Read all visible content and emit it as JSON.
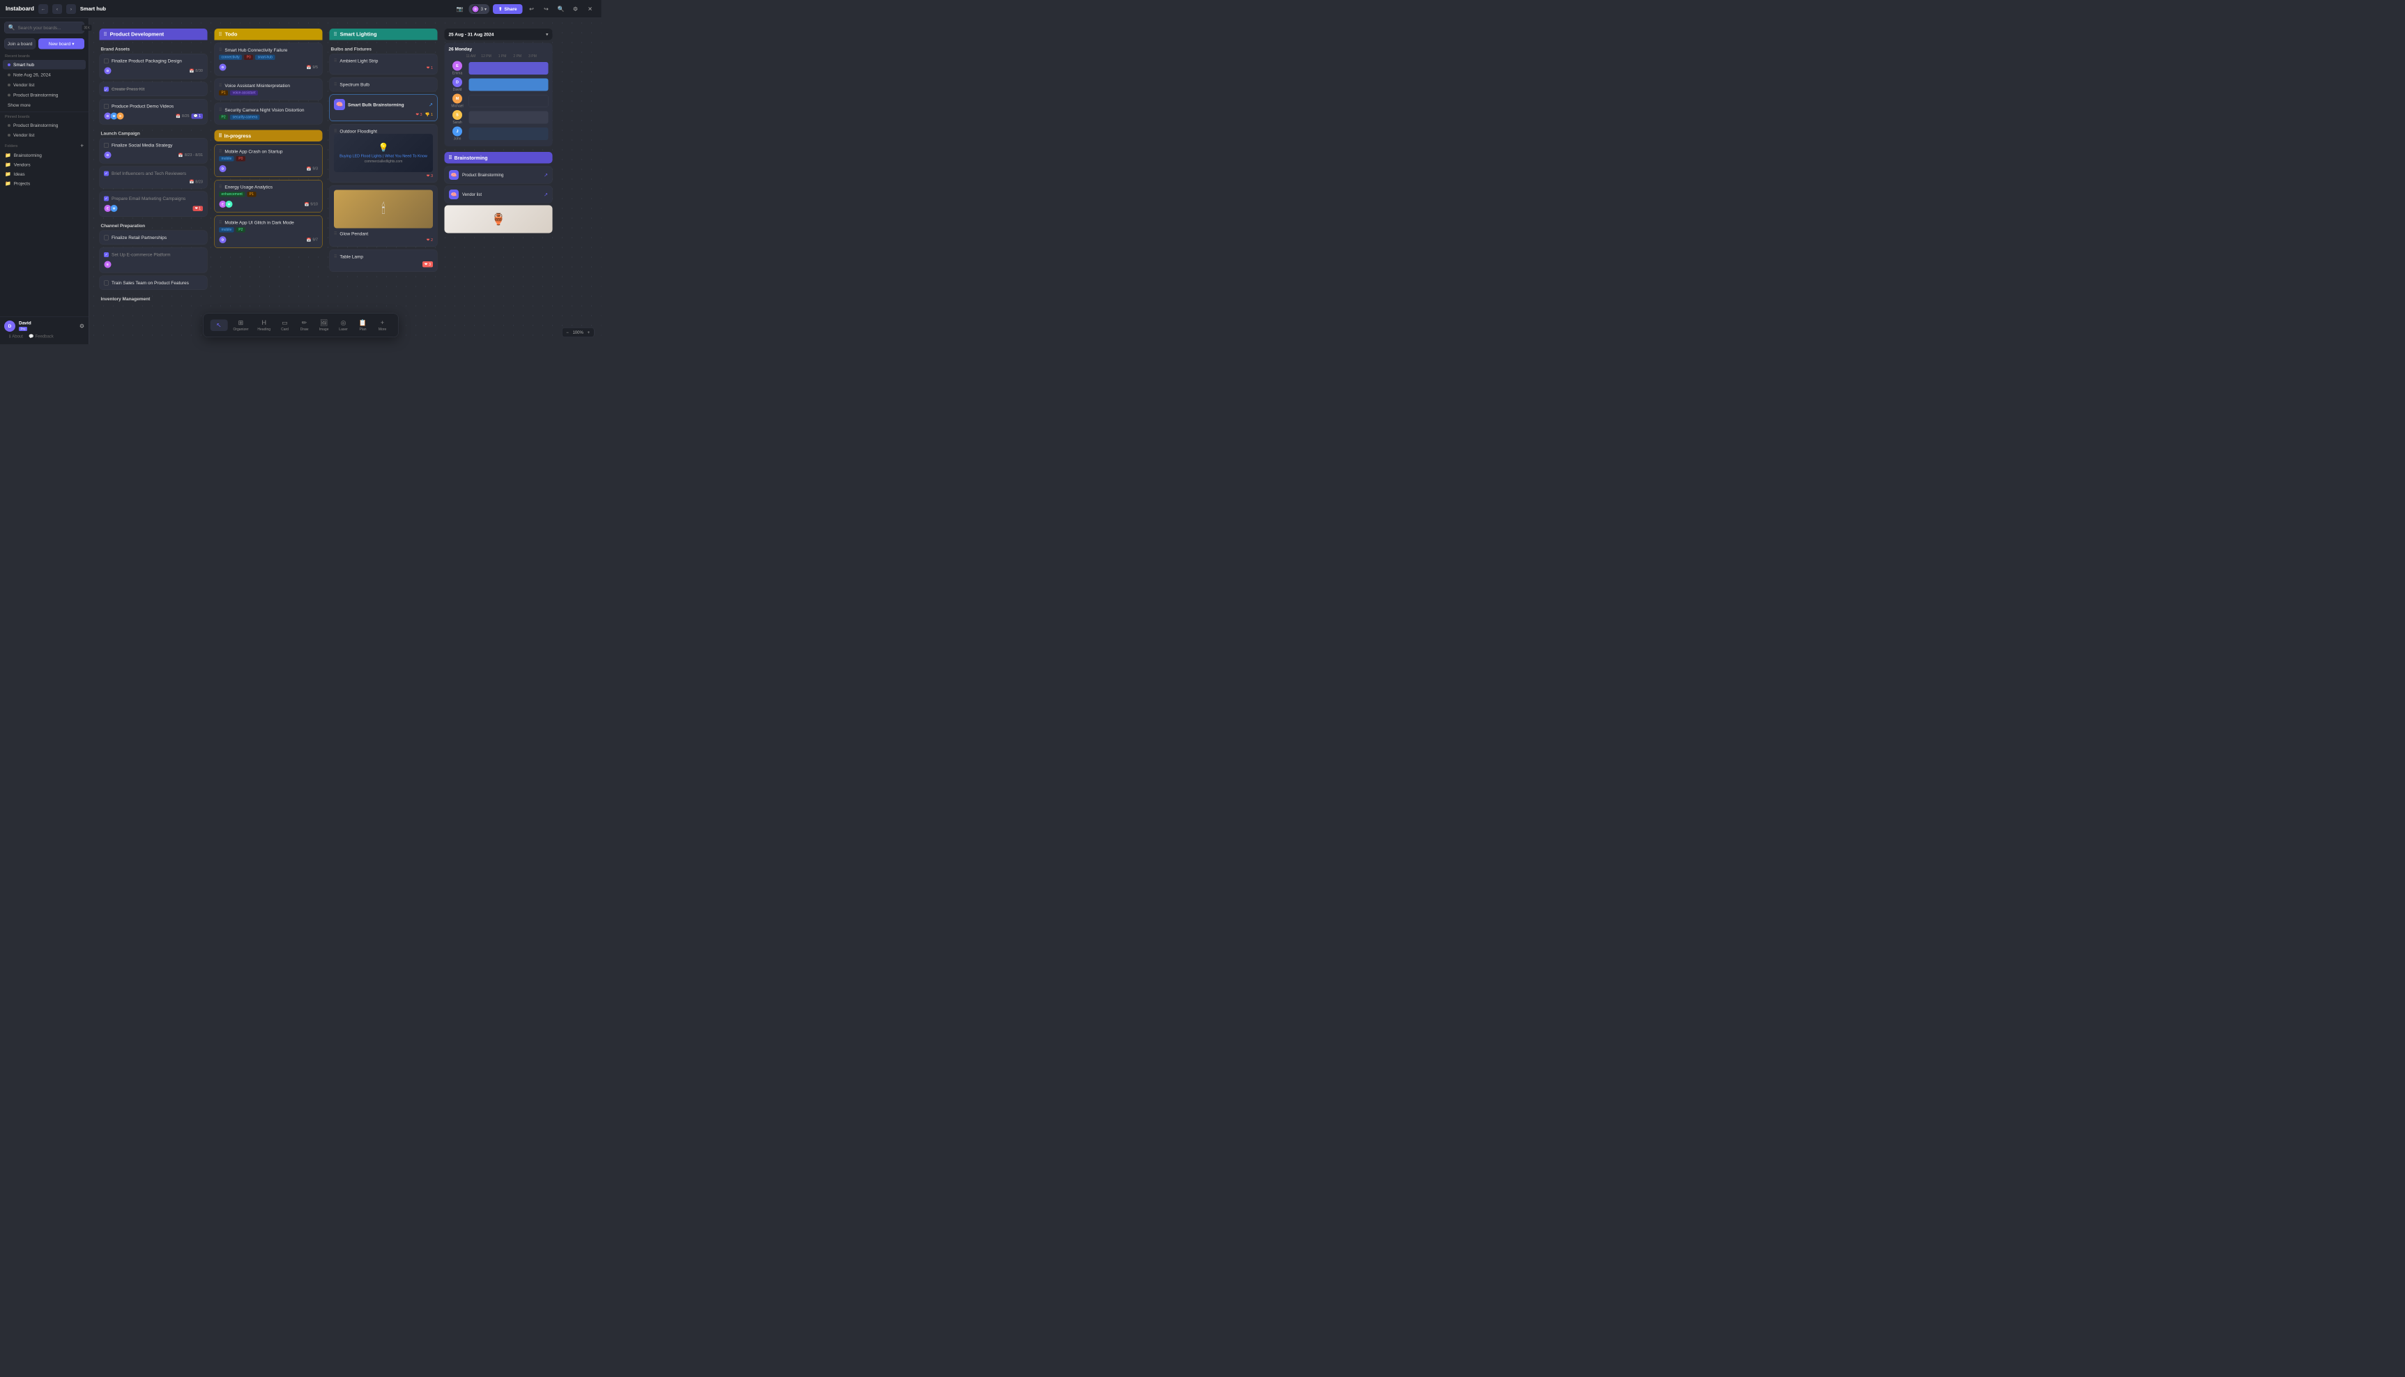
{
  "app": {
    "name": "Instaboard",
    "board_name": "Smart hub",
    "close_icon": "✕",
    "back_icon": "←",
    "forward_icon": "→",
    "undo_icon": "↩",
    "redo_icon": "↪"
  },
  "topbar": {
    "board_name": "Smart hub",
    "members_count": "3",
    "share_label": "Share",
    "share_icon": "⬆",
    "search_icon": "🔍",
    "settings_icon": "⚙",
    "close_icon": "✕",
    "undo_icon": "↩",
    "redo_icon": "↪",
    "camera_icon": "📷"
  },
  "sidebar": {
    "search_placeholder": "Search your boards...",
    "search_shortcut": "⌘K",
    "join_board_label": "Join a board",
    "new_board_label": "New board",
    "recent_label": "Recent boards",
    "recent_items": [
      {
        "label": "Smart hub",
        "active": true
      },
      {
        "label": "Note Aug 26, 2024"
      },
      {
        "label": "Vendor list"
      },
      {
        "label": "Product Brainstorming"
      }
    ],
    "show_more": "Show more",
    "pinned_label": "Pinned boards",
    "pinned_items": [
      {
        "label": "Product Brainstorming"
      },
      {
        "label": "Vendor list"
      }
    ],
    "folders_label": "Folders",
    "folders": [
      {
        "label": "Brainstorming"
      },
      {
        "label": "Vendors"
      },
      {
        "label": "Ideas"
      },
      {
        "label": "Projects"
      }
    ],
    "about_label": "About",
    "feedback_label": "Feedback",
    "user": {
      "name": "David",
      "badge": "Pro",
      "initial": "D"
    }
  },
  "columns": {
    "product_dev": {
      "title": "Product Development",
      "sections": {
        "brand_assets": {
          "label": "Brand Assets",
          "cards": [
            {
              "title": "Finalize Product Packaging Design",
              "checked": false,
              "date": "8/30",
              "avatar_colors": [
                "#7c6af7"
              ]
            },
            {
              "title": "Create Press Kit",
              "checked": true,
              "date": ""
            },
            {
              "title": "Produce Product Demo Videos",
              "checked": false,
              "date": "8/25",
              "has_badge": true,
              "badge_count": "1",
              "avatars": [
                "#7c6af7",
                "#4a9af7",
                "#f7a24a"
              ]
            }
          ]
        },
        "launch_campaign": {
          "label": "Launch Campaign",
          "cards": [
            {
              "title": "Finalize Social Media Strategy",
              "checked": false,
              "date": "8/23 - 8/31",
              "avatar_colors": [
                "#7c6af7"
              ]
            },
            {
              "title": "Brief Influencers and Tech Reviewers",
              "checked": true,
              "date": "8/23"
            },
            {
              "title": "Prepare Email Marketing Campaigns",
              "checked": true,
              "date": "",
              "heart": "1",
              "avatars": [
                "#c46af7",
                "#4a9af7"
              ]
            }
          ]
        },
        "channel_prep": {
          "label": "Channel Preparation",
          "cards": [
            {
              "title": "Finalize Retail Partnerships",
              "checked": false
            },
            {
              "title": "Set Up E-commerce Platform",
              "checked": true,
              "avatar_colors": [
                "#c46af7"
              ]
            },
            {
              "title": "Train Sales Team on Product Features",
              "checked": false
            }
          ]
        },
        "inventory": {
          "label": "Inventory Management"
        }
      }
    },
    "todo": {
      "title": "Todo",
      "cards": [
        {
          "title": "Smart Hub Connectivity Failure",
          "tags": [
            "connectivity",
            "P0",
            "snart-hub"
          ],
          "date": "9/5",
          "avatar_colors": [
            "#7c6af7"
          ]
        },
        {
          "title": "Voice Assistant Misinterpretation",
          "tags": [
            "P1",
            "voice-assistant"
          ],
          "avatar_colors": []
        },
        {
          "title": "Security Camera Night Vision Distortion",
          "tags": [
            "P2",
            "security-camera"
          ],
          "avatar_colors": []
        }
      ]
    },
    "smart_lighting": {
      "title": "Smart Lighting",
      "sections": {
        "bulbs_fixtures": {
          "label": "Bulbs and Fixtures",
          "cards": [
            {
              "title": "Ambient Light Strip",
              "heart": "1"
            },
            {
              "title": "Spectrum Bulb"
            },
            {
              "title": "Smart Bulk Brainstorming",
              "has_external": true,
              "hearts": "3",
              "thumbsdown": "1"
            },
            {
              "title": "Outdoor Floodlight",
              "has_image": true,
              "hearts": "3",
              "image_text": "Buying LED Flood Lights | What You Need To Know",
              "image_sub": "commercialledlights.com"
            },
            {
              "title": "Glow Pendant",
              "heart": "2"
            },
            {
              "title": "Table Lamp",
              "hearts": "3"
            }
          ]
        }
      }
    }
  },
  "inprogress": {
    "title": "In-progress",
    "cards": [
      {
        "title": "Mobile App Crash on Startup",
        "tags": [
          "mobile",
          "P0"
        ],
        "date": "9/3",
        "avatar_colors": [
          "#7c6af7"
        ]
      },
      {
        "title": "Energy Usage Analytics",
        "tags": [
          "enhancement",
          "P1"
        ],
        "date": "9/10",
        "avatars": [
          "#c46af7",
          "#4af7c4"
        ]
      },
      {
        "title": "Mobile App UI Glitch in Dark Mode",
        "tags": [
          "mobile",
          "P2"
        ],
        "date": "9/7",
        "avatar_colors": [
          "#7c6af7"
        ]
      }
    ]
  },
  "calendar": {
    "title": "25 Aug - 31 Aug 2024",
    "day": "26 Monday",
    "times": [
      "11 AM",
      "12 PM",
      "1 PM",
      "2 PM",
      "3 PM"
    ],
    "people": [
      {
        "name": "Emma",
        "initial": "E",
        "color": "#c46af7"
      },
      {
        "name": "David",
        "initial": "D",
        "color": "#7c6af7"
      },
      {
        "name": "Michael",
        "initial": "M",
        "color": "#f7a24a"
      },
      {
        "name": "Sarah",
        "initial": "S",
        "color": "#f7c24a"
      },
      {
        "name": "John",
        "initial": "J",
        "color": "#4a9af7"
      }
    ]
  },
  "brainstorm": {
    "title": "Brainstorming",
    "items": [
      {
        "name": "Product Brainstorming",
        "heart": "1"
      },
      {
        "name": "Vendor list",
        "heart": "1"
      }
    ]
  },
  "toolbar": {
    "items": [
      {
        "label": "Organizer",
        "icon": "⊞",
        "active": false
      },
      {
        "label": "Heading",
        "icon": "H",
        "active": false
      },
      {
        "label": "Card",
        "icon": "▭",
        "active": false
      },
      {
        "label": "Draw",
        "icon": "✏",
        "active": false
      },
      {
        "label": "Image",
        "icon": "🖼",
        "active": false
      },
      {
        "label": "Laser",
        "icon": "◎",
        "active": false
      },
      {
        "label": "Plan",
        "icon": "📋",
        "active": false
      },
      {
        "label": "More",
        "icon": "+",
        "active": false
      }
    ],
    "cursor_icon": "↖",
    "zoom": "100%"
  }
}
